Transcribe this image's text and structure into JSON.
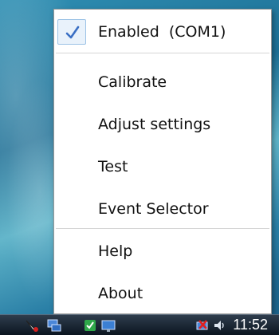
{
  "menu": {
    "items": [
      {
        "label": "Enabled  (COM1)",
        "checked": true
      },
      {
        "label": "Calibrate"
      },
      {
        "label": "Adjust settings"
      },
      {
        "label": "Test"
      },
      {
        "label": "Event Selector"
      },
      {
        "label": "Help"
      },
      {
        "label": "About"
      }
    ]
  },
  "taskbar": {
    "clock": "11:52",
    "tray_icons": [
      "pen-tablet-icon",
      "network-icon",
      "security-shield-icon",
      "monitor-icon",
      "network-error-icon",
      "volume-icon"
    ]
  },
  "colors": {
    "accent": "#3a6fc4",
    "check_highlight": "#e9f2fb",
    "taskbar": "#1a2633"
  }
}
